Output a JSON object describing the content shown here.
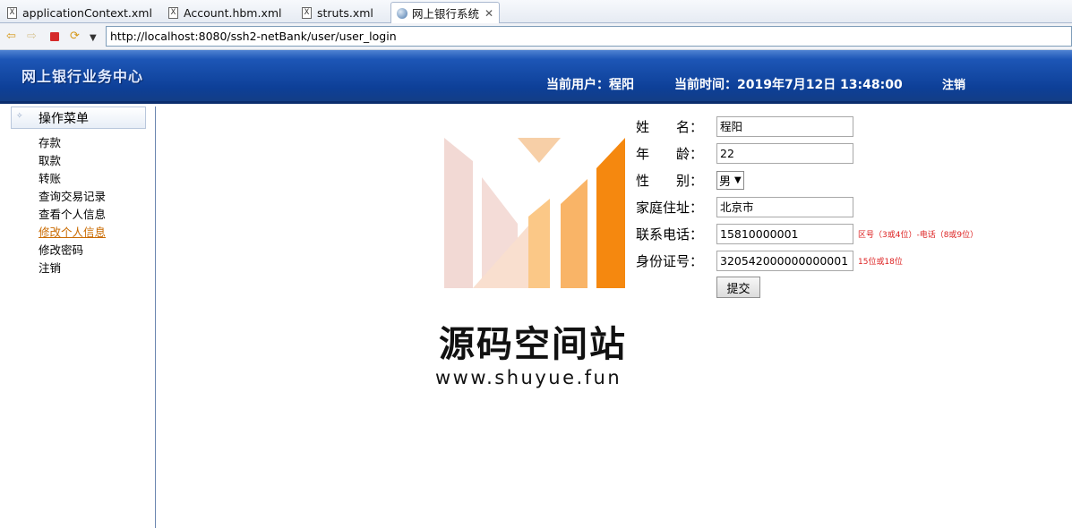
{
  "tabs": [
    {
      "label": "applicationContext.xml",
      "icon": "xml-file-icon"
    },
    {
      "label": "Account.hbm.xml",
      "icon": "xml-file-icon"
    },
    {
      "label": "struts.xml",
      "icon": "xml-file-icon"
    },
    {
      "label": "网上银行系统",
      "icon": "globe-icon",
      "active": true
    }
  ],
  "toolbar": {
    "url": "http://localhost:8080/ssh2-netBank/user/user_login"
  },
  "header": {
    "title": "网上银行业务中心",
    "current_user": "当前用户：程阳",
    "current_time": "当前时间：2019年7月12日 13:48:00",
    "logout": "注销"
  },
  "sidebar": {
    "heading": "操作菜单",
    "items": [
      {
        "label": "存款"
      },
      {
        "label": "取款"
      },
      {
        "label": "转账"
      },
      {
        "label": "查询交易记录"
      },
      {
        "label": "查看个人信息"
      },
      {
        "label": "修改个人信息",
        "active": true
      },
      {
        "label": "修改密码"
      },
      {
        "label": "注销"
      }
    ]
  },
  "form": {
    "name_label": "姓　　名：",
    "name_value": "程阳",
    "age_label": "年　　龄：",
    "age_value": "22",
    "gender_label": "性　　别：",
    "gender_value": "男",
    "address_label": "家庭住址：",
    "address_value": "北京市",
    "phone_label": "联系电话：",
    "phone_value": "15810000001",
    "phone_hint": "区号（3或4位）-电话（8或9位）",
    "idcard_label": "身份证号：",
    "idcard_value": "320542000000000001",
    "idcard_hint": "15位或18位",
    "submit_label": "提交"
  },
  "watermark": {
    "title": "源码空间站",
    "url": "www.shuyue.fun"
  },
  "colors": {
    "header_blue": "#1d56b6",
    "active_menu": "#c96a00",
    "hint_red": "#dd2222",
    "logo_orange": "#f5880f"
  }
}
